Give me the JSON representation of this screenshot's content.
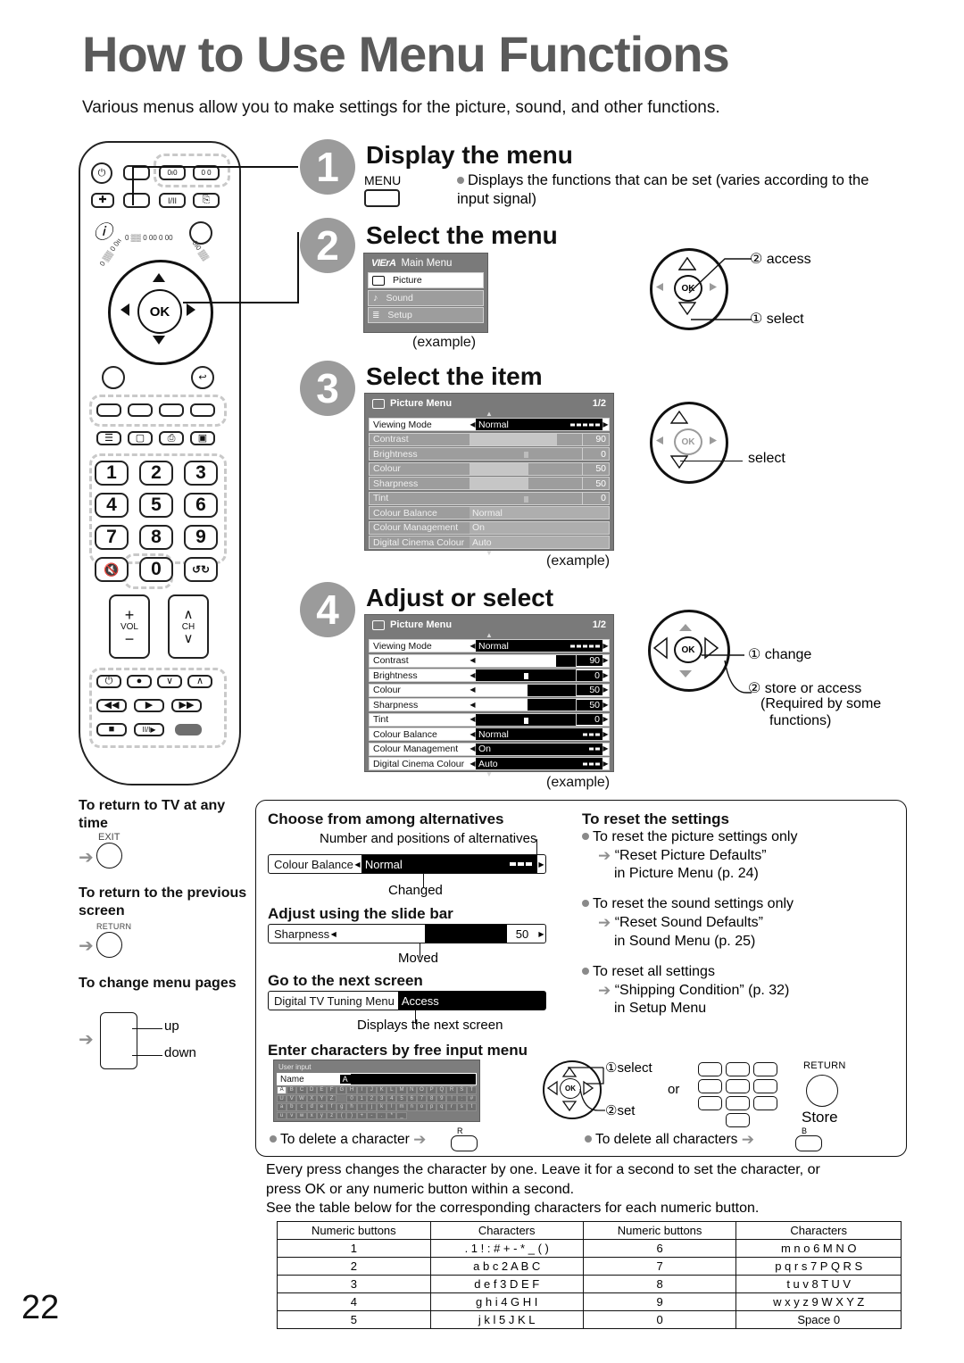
{
  "page": {
    "title": "How to Use Menu Functions",
    "intro": "Various menus allow you to make settings for the picture, sound, and other functions.",
    "page_number": "22"
  },
  "steps": [
    {
      "num": "1",
      "heading": "Display the menu",
      "button_label": "MENU",
      "description": "Displays the functions that can be set (varies according to the input signal)"
    },
    {
      "num": "2",
      "heading": "Select the menu",
      "example_caption": "(example)",
      "cursor": {
        "first": "① select",
        "second": "② access"
      }
    },
    {
      "num": "3",
      "heading": "Select the item",
      "example_caption": "(example)",
      "cursor": {
        "first": "select"
      }
    },
    {
      "num": "4",
      "heading": "Adjust or select",
      "example_caption": "(example)",
      "cursor": {
        "first": "① change",
        "second": "② store or access",
        "second_note_1": "(Required by some",
        "second_note_2": "functions)"
      }
    }
  ],
  "main_menu": {
    "brand": "VIErA",
    "title": "Main Menu",
    "items": [
      {
        "label": "Picture",
        "icon": "picture-icon",
        "selected": true
      },
      {
        "label": "Sound",
        "icon": "note-icon",
        "selected": false
      },
      {
        "label": "Setup",
        "icon": "list-icon",
        "selected": false
      }
    ]
  },
  "picture_menu_step3": {
    "title": "Picture Menu",
    "page_indicator": "1/2",
    "rows": [
      {
        "label": "Viewing Mode",
        "value": "Normal",
        "type": "option",
        "selected": true,
        "dots": 5
      },
      {
        "label": "Contrast",
        "value": "90",
        "type": "slider",
        "fill": 78
      },
      {
        "label": "Brightness",
        "value": "0",
        "type": "slider-center",
        "fill": 50
      },
      {
        "label": "Colour",
        "value": "50",
        "type": "slider",
        "fill": 52
      },
      {
        "label": "Sharpness",
        "value": "50",
        "type": "slider",
        "fill": 52
      },
      {
        "label": "Tint",
        "value": "0",
        "type": "slider-center",
        "fill": 50
      },
      {
        "label": "Colour Balance",
        "value": "Normal",
        "type": "option"
      },
      {
        "label": "Colour Management",
        "value": "On",
        "type": "option"
      },
      {
        "label": "Digital Cinema Colour",
        "value": "Auto",
        "type": "option"
      }
    ]
  },
  "picture_menu_step4": {
    "title": "Picture Menu",
    "page_indicator": "1/2",
    "rows": [
      {
        "label": "Viewing Mode",
        "value": "Normal",
        "type": "option",
        "dots": 5
      },
      {
        "label": "Contrast",
        "value": "90",
        "type": "slider",
        "fill": 80
      },
      {
        "label": "Brightness",
        "value": "0",
        "type": "slider-center",
        "fill": 50
      },
      {
        "label": "Colour",
        "value": "50",
        "type": "slider",
        "fill": 52
      },
      {
        "label": "Sharpness",
        "value": "50",
        "type": "slider",
        "fill": 52
      },
      {
        "label": "Tint",
        "value": "0",
        "type": "slider-center",
        "fill": 50
      },
      {
        "label": "Colour Balance",
        "value": "Normal",
        "type": "option",
        "dots": 3
      },
      {
        "label": "Colour Management",
        "value": "On",
        "type": "option",
        "dots": 2
      },
      {
        "label": "Digital Cinema Colour",
        "value": "Auto",
        "type": "option",
        "dots": 3
      }
    ]
  },
  "side_notes": [
    {
      "heading": "To return to TV at any time",
      "button": "EXIT",
      "shape": "circle"
    },
    {
      "heading": "To return to the previous screen",
      "button": "RETURN",
      "shape": "circle"
    },
    {
      "heading": "To change menu pages",
      "shape": "rect",
      "label_up": "up",
      "label_down": "down"
    }
  ],
  "box": {
    "alternatives": {
      "heading": "Choose from among alternatives",
      "top_caption": "Number and positions of alternatives",
      "row": {
        "label": "Colour Balance",
        "value": "Normal",
        "dots": 3
      },
      "bottom_caption": "Changed"
    },
    "slide_bar": {
      "heading": "Adjust using the slide bar",
      "row": {
        "label": "Sharpness",
        "value": "50",
        "fill": 52
      },
      "bottom_caption": "Moved"
    },
    "next_screen": {
      "heading": "Go to the next screen",
      "row": {
        "label": "Digital TV Tuning Menu",
        "value": "Access"
      },
      "bottom_caption": "Displays the next screen"
    },
    "free_input": {
      "heading": "Enter characters by free input menu",
      "osd": {
        "title": "User input",
        "field_label": "Name",
        "cursor_char": "A",
        "keyboard_rows": [
          [
            "A",
            "B",
            "C",
            "D",
            "E",
            "F",
            "G",
            "H",
            "I",
            "J",
            "K",
            "L",
            "M",
            "N",
            "O",
            "P",
            "Q",
            "R",
            "S",
            "T"
          ],
          [
            "U",
            "V",
            "W",
            "X",
            "Y",
            "Z",
            "",
            "0",
            "1",
            "2",
            "3",
            "4",
            "5",
            "6",
            "7",
            "8",
            "9",
            "!",
            ":",
            "#"
          ],
          [
            "a",
            "b",
            "c",
            "d",
            "e",
            "f",
            "g",
            "h",
            "i",
            "j",
            "k",
            "l",
            "m",
            "n",
            "o",
            "p",
            "q",
            "r",
            "s",
            "t"
          ],
          [
            "u",
            "v",
            "w",
            "x",
            "y",
            "z",
            "(",
            ")",
            "+",
            "-",
            ".",
            "*",
            "_",
            "",
            "",
            "",
            "",
            "",
            "",
            ""
          ]
        ],
        "selected_key": "A"
      },
      "cursor": {
        "first": "①select",
        "second": "②set"
      },
      "or_label": "or",
      "return_label": "RETURN",
      "store_label": "Store",
      "delete_one": "To delete a character",
      "delete_one_key": "R",
      "delete_all": "To delete all characters",
      "delete_all_key": "B"
    },
    "reset": {
      "heading": "To reset the settings",
      "items": [
        {
          "bullet": "To reset the picture settings only",
          "arrow_1": "“Reset Picture Defaults”",
          "arrow_2": "in Picture Menu (p. 24)"
        },
        {
          "bullet": "To reset the sound settings only",
          "arrow_1": "“Reset Sound Defaults”",
          "arrow_2": "in Sound Menu (p. 25)"
        },
        {
          "bullet": "To reset all settings",
          "arrow_1": "“Shipping Condition” (p. 32)",
          "arrow_2": "in Setup Menu"
        }
      ]
    },
    "paragraph": {
      "line1": "Every press changes the character by one. Leave it for a second to set the character, or",
      "line2": "press OK or any numeric button within a second.",
      "line3": "See the table below for the corresponding characters for each numeric button."
    },
    "char_table": {
      "headers": [
        "Numeric buttons",
        "Characters",
        "Numeric buttons",
        "Characters"
      ],
      "rows": [
        [
          "1",
          ". 1 ! : # + - * _ ( )",
          "6",
          "m n o 6 M N O"
        ],
        [
          "2",
          "a b c 2 A B C",
          "7",
          "p q r s 7 P Q R S"
        ],
        [
          "3",
          "d e f 3 D E F",
          "8",
          "t u v 8 T U V"
        ],
        [
          "4",
          "g h i 4 G H I",
          "9",
          "w x y z 9 W X Y Z"
        ],
        [
          "5",
          "j k l 5 J K L",
          "0",
          "Space 0"
        ]
      ]
    }
  },
  "remote": {
    "numeric_keys": [
      "1",
      "2",
      "3",
      "4",
      "5",
      "6",
      "7",
      "8",
      "9",
      "0"
    ],
    "vol_label": "VOL",
    "ch_label": "CH",
    "ok_label": "OK"
  }
}
